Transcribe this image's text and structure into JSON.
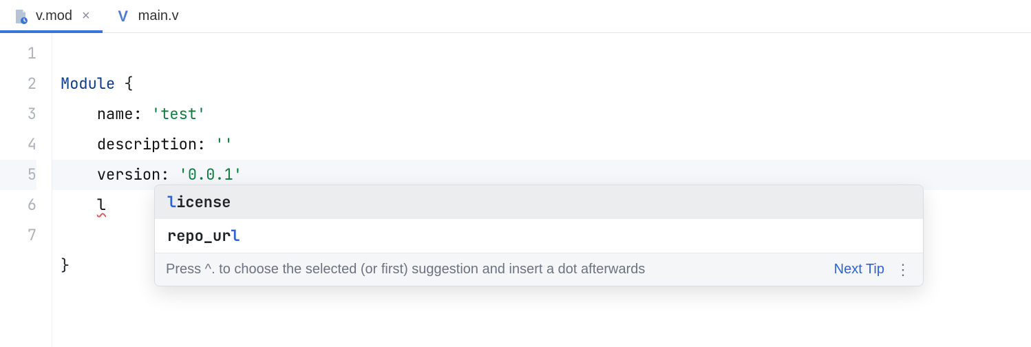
{
  "tabs": {
    "active": {
      "label": "v.mod"
    },
    "other": {
      "label": "main.v"
    }
  },
  "gutter": {
    "l1": "1",
    "l2": "2",
    "l3": "3",
    "l4": "4",
    "l5": "5",
    "l6": "6",
    "l7": "7"
  },
  "code": {
    "l1_kw": "Module",
    "l1_brace": " {",
    "indent": "    ",
    "l2_key": "name",
    "colon": ":",
    "sp": " ",
    "l2_val": "'test'",
    "l3_key": "description",
    "l3_val": "''",
    "l4_key": "version",
    "l4_val": "'0.0.1'",
    "l5_partial": "l",
    "l7_brace": "}"
  },
  "autocomplete": {
    "opt0_pre": "l",
    "opt0_rest": "icense",
    "opt1_pre": "repo_ur",
    "opt1_match": "l",
    "hint": "Press ^. to choose the selected (or first) suggestion and insert a dot afterwards",
    "next_tip": "Next Tip"
  }
}
